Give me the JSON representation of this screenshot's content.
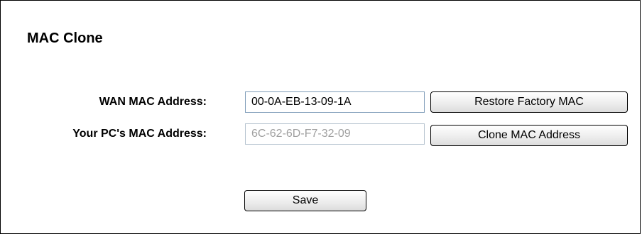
{
  "page": {
    "title": "MAC Clone"
  },
  "wan": {
    "label": "WAN MAC Address:",
    "value": "00-0A-EB-13-09-1A",
    "restore_button": "Restore Factory MAC"
  },
  "pc": {
    "label": "Your PC's MAC Address:",
    "value": "6C-62-6D-F7-32-09",
    "clone_button": "Clone MAC Address"
  },
  "actions": {
    "save_label": "Save"
  }
}
